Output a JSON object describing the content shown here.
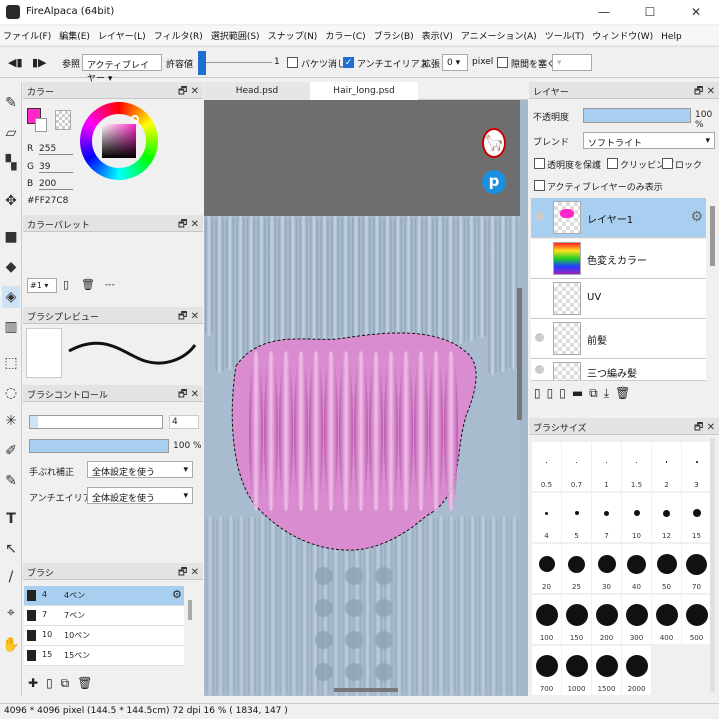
{
  "window": {
    "title": "FireAlpaca (64bit)",
    "minimize": "—",
    "maximize": "☐",
    "close": "✕"
  },
  "menu": [
    "ファイル(F)",
    "編集(E)",
    "レイヤー(L)",
    "フィルタ(R)",
    "選択範囲(S)",
    "スナップ(N)",
    "カラー(C)",
    "ブラシ(B)",
    "表示(V)",
    "アニメーション(A)",
    "ツール(T)",
    "ウィンドウ(W)",
    "Help"
  ],
  "toolbar": {
    "reference_label": "参照",
    "reference_value": "アクティブレイヤー",
    "tolerance_label": "許容値",
    "tolerance_value": "1",
    "bucket_clear_label": "バケツ消し",
    "bucket_clear": false,
    "antialias_label": "アンチエイリアス",
    "antialias": true,
    "expand_label": "拡張",
    "expand_value": "0",
    "expand_unit": "pixel",
    "gap_close_label": "隙間を塞ぐ",
    "gap_close": false
  },
  "tabs": [
    "Head.psd",
    "Hair_long.psd"
  ],
  "active_tab": 1,
  "color_panel": {
    "title": "カラー",
    "r_label": "R",
    "r": "255",
    "g_label": "G",
    "g": "39",
    "b_label": "B",
    "b": "200",
    "hex": "#FF27C8",
    "primary_color": "#ff27c8"
  },
  "palette_panel": {
    "title": "カラーパレット",
    "row1": [
      "#111111",
      "#222222",
      "#333333",
      "#444444",
      "#555555",
      "#777777",
      "#999999",
      "#aaaaaa",
      "#cccccc",
      "#ffe5c2"
    ],
    "row2": [
      "#f5c28e",
      "#f2b081",
      "#ef9d6a",
      "#e76a4d",
      "#e04040",
      "#b02040",
      "#c01870",
      "#8a1060",
      "#f0d0e0",
      "#ffe6b0"
    ],
    "palette_id": "#1",
    "dash": "---"
  },
  "brush_preview_panel": {
    "title": "ブラシプレビュー"
  },
  "brush_control_panel": {
    "title": "ブラシコントロール",
    "size_value": "4",
    "opacity_value": "100 %",
    "opacity_pct": 100,
    "stabilizer_label": "手ぶれ補正",
    "stabilizer_value": "全体設定を使う",
    "antialias_label": "アンチエイリアス",
    "antialias_value": "全体設定を使う"
  },
  "brush_panel": {
    "title": "ブラシ",
    "items": [
      {
        "size": "4",
        "name": "4ペン"
      },
      {
        "size": "7",
        "name": "7ペン"
      },
      {
        "size": "10",
        "name": "10ペン"
      },
      {
        "size": "15",
        "name": "15ペン"
      }
    ]
  },
  "layer_panel": {
    "title": "レイヤー",
    "opacity_label": "不透明度",
    "opacity_value": "100 %",
    "opacity_pct": 100,
    "blend_label": "ブレンド",
    "blend_value": "ソフトライト",
    "protect_alpha_label": "透明度を保護",
    "clipping_label": "クリッピング",
    "lock_label": "ロック",
    "active_only_label": "アクティブレイヤーのみ表示",
    "layers": [
      "レイヤー1",
      "色変えカラー",
      "UV",
      "前髪",
      "三つ編み髪"
    ]
  },
  "brush_size_panel": {
    "title": "ブラシサイズ",
    "sizes": [
      "0.5",
      "0.7",
      "1",
      "1.5",
      "2",
      "3",
      "4",
      "5",
      "7",
      "10",
      "12",
      "15",
      "20",
      "25",
      "30",
      "40",
      "50",
      "70",
      "100",
      "150",
      "200",
      "300",
      "400",
      "500",
      "700",
      "1000",
      "1500",
      "2000"
    ]
  },
  "status": {
    "text": "4096 * 4096 pixel (144.5 * 144.5cm) 72 dpi 16 % ( 1834, 147 )"
  }
}
